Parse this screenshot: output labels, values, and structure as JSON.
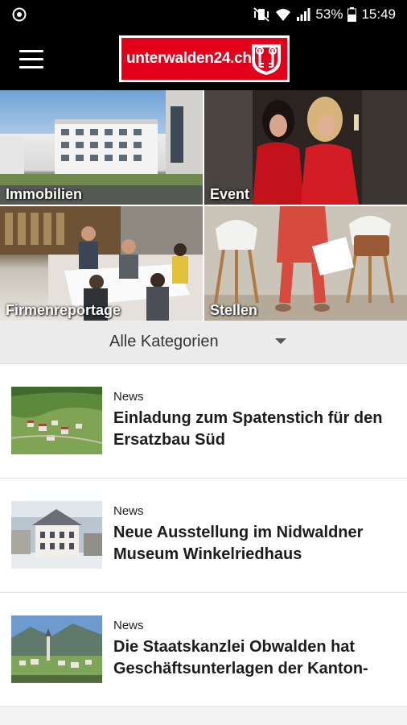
{
  "status_bar": {
    "battery": "53%",
    "time": "15:49"
  },
  "app_bar": {
    "logo_text": "unterwalden24.ch"
  },
  "tiles": [
    {
      "label": "Immobilien"
    },
    {
      "label": "Event"
    },
    {
      "label": "Firmenreportage"
    },
    {
      "label": "Stellen"
    }
  ],
  "filter": {
    "selected": "Alle Kategorien"
  },
  "news": [
    {
      "category": "News",
      "title": "Einladung zum Spatenstich für den Ersatzbau Süd"
    },
    {
      "category": "News",
      "title": "Neue Ausstellung im Nidwaldner Museum Winkelriedhaus"
    },
    {
      "category": "News",
      "title": "Die Staatskanzlei Obwalden hat Geschäftsunterlagen der Kanton-"
    }
  ],
  "colors": {
    "brand_red": "#e2001a",
    "header_bg": "#000000"
  }
}
